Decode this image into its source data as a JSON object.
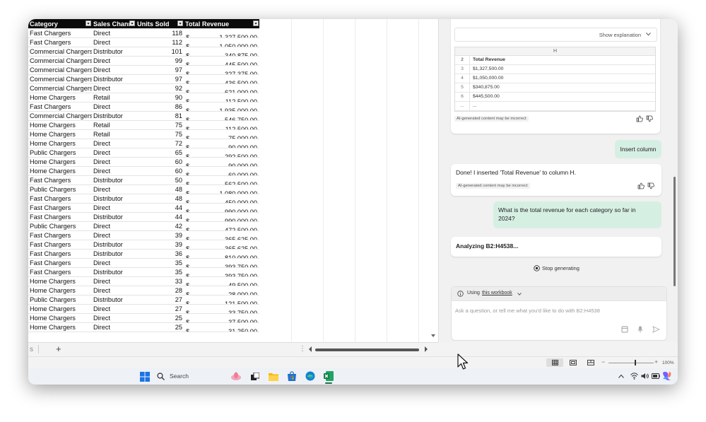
{
  "sheet": {
    "headers": [
      "Category",
      "Sales Chann",
      "Units Sold",
      "Total Revenue"
    ],
    "rows": [
      [
        "Fast Chargers",
        "Direct",
        "118",
        "1,327,500.00"
      ],
      [
        "Fast Chargers",
        "Direct",
        "112",
        "1,050,000.00"
      ],
      [
        "Commercial Chargers",
        "Distributor",
        "101",
        "340,875.00"
      ],
      [
        "Commercial Chargers",
        "Direct",
        "99",
        "445,500.00"
      ],
      [
        "Commercial Chargers",
        "Direct",
        "97",
        "327,375.00"
      ],
      [
        "Commercial Chargers",
        "Distributor",
        "97",
        "436,500.00"
      ],
      [
        "Commercial Chargers",
        "Direct",
        "92",
        "621,000.00"
      ],
      [
        "Home Chargers",
        "Retail",
        "90",
        "112,500.00"
      ],
      [
        "Fast Chargers",
        "Direct",
        "86",
        "1,935,000.00"
      ],
      [
        "Commercial Chargers",
        "Distributor",
        "81",
        "546,750.00"
      ],
      [
        "Home Chargers",
        "Retail",
        "75",
        "112,500.00"
      ],
      [
        "Home Chargers",
        "Retail",
        "75",
        "75,000.00"
      ],
      [
        "Home Chargers",
        "Direct",
        "72",
        "90,000.00"
      ],
      [
        "Public Chargers",
        "Direct",
        "65",
        "292,500.00"
      ],
      [
        "Home Chargers",
        "Direct",
        "60",
        "90,000.00"
      ],
      [
        "Home Chargers",
        "Direct",
        "60",
        "60,000.00"
      ],
      [
        "Fast Chargers",
        "Distributor",
        "50",
        "562,500.00"
      ],
      [
        "Public Chargers",
        "Direct",
        "48",
        "1,080,000.00"
      ],
      [
        "Fast Chargers",
        "Distributor",
        "48",
        "450,000.00"
      ],
      [
        "Fast Chargers",
        "Direct",
        "44",
        "990,000.00"
      ],
      [
        "Fast Chargers",
        "Distributor",
        "44",
        "990,000.00"
      ],
      [
        "Public Chargers",
        "Direct",
        "42",
        "472,500.00"
      ],
      [
        "Fast Chargers",
        "Direct",
        "39",
        "365,625.00"
      ],
      [
        "Fast Chargers",
        "Distributor",
        "39",
        "365,625.00"
      ],
      [
        "Fast Chargers",
        "Distributor",
        "36",
        "810,000.00"
      ],
      [
        "Fast Chargers",
        "Direct",
        "35",
        "393,750.00"
      ],
      [
        "Fast Chargers",
        "Distributor",
        "35",
        "393,750.00"
      ],
      [
        "Home Chargers",
        "Direct",
        "33",
        "49,500.00"
      ],
      [
        "Home Chargers",
        "Direct",
        "28",
        "28,000.00"
      ],
      [
        "Public Chargers",
        "Distributor",
        "27",
        "121,500.00"
      ],
      [
        "Home Chargers",
        "Direct",
        "27",
        "33,750.00"
      ],
      [
        "Home Chargers",
        "Direct",
        "25",
        "37,500.00"
      ],
      [
        "Home Chargers",
        "Direct",
        "25",
        "31,250.00"
      ]
    ],
    "currency_symbol": "$",
    "tab_partial": "s",
    "add_sheet": "+",
    "more": "⋮"
  },
  "copilot": {
    "show_explanation": "Show explanation",
    "preview": {
      "column_letter": "H",
      "rows": [
        {
          "num": "2",
          "val": "Total Revenue"
        },
        {
          "num": "3",
          "val": "$1,327,500.00"
        },
        {
          "num": "4",
          "val": "$1,050,000.00"
        },
        {
          "num": "5",
          "val": "$340,875.00"
        },
        {
          "num": "6",
          "val": "$445,500.00"
        },
        {
          "num": "...",
          "val": "..."
        }
      ]
    },
    "ai_disclaimer": "AI-generated content may be incorrect",
    "insert_column": "Insert column",
    "done_msg": "Done! I inserted 'Total Revenue' to column H.",
    "user_question": "What is the total revenue for each category so far in 2024?",
    "analyzing": "Analyzing B2:H4538...",
    "stop_generating": "Stop generating",
    "using_label": "Using",
    "using_link": "this workbook",
    "input_placeholder": "Ask a question, or tell me what you'd like to do with B2:H4538"
  },
  "status": {
    "zoom": "100%",
    "zoom_level_fraction": 0.6
  },
  "taskbar": {
    "search_placeholder": "Search"
  },
  "colors": {
    "header_bg": "#0b0b0b",
    "bubble_green": "#d6efe3",
    "excel_green": "#1d6f42"
  }
}
